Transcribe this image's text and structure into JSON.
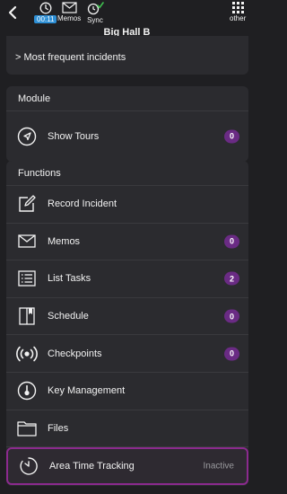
{
  "topbar": {
    "time_badge": "00:11",
    "memos_label": "Memos",
    "sync_label": "Sync",
    "other_label": "other"
  },
  "page_title": "Big Hall B",
  "frequent": {
    "label": "Most frequent incidents",
    "chevron": ">"
  },
  "module": {
    "heading": "Module",
    "items": [
      {
        "label": "Show Tours",
        "badge": "0",
        "icon": "navigation-arrow-icon"
      }
    ]
  },
  "functions": {
    "heading": "Functions",
    "items": [
      {
        "label": "Record Incident",
        "icon": "edit-icon"
      },
      {
        "label": "Memos",
        "badge": "0",
        "icon": "envelope-icon"
      },
      {
        "label": "List Tasks",
        "badge": "2",
        "icon": "list-icon"
      },
      {
        "label": "Schedule",
        "badge": "0",
        "icon": "book-icon"
      },
      {
        "label": "Checkpoints",
        "badge": "0",
        "icon": "radio-signal-icon"
      },
      {
        "label": "Key Management",
        "icon": "key-tag-icon"
      },
      {
        "label": "Files",
        "icon": "folder-icon"
      },
      {
        "label": "Area Time Tracking",
        "status": "Inactive",
        "icon": "timer-icon"
      }
    ]
  },
  "colors": {
    "background": "#1f1f22",
    "card": "#2b2b2f",
    "badge": "#6a2b84",
    "highlight_border": "#8b2a8e",
    "time_badge": "#2d8fd5",
    "sync_check": "#3fbf4f"
  }
}
